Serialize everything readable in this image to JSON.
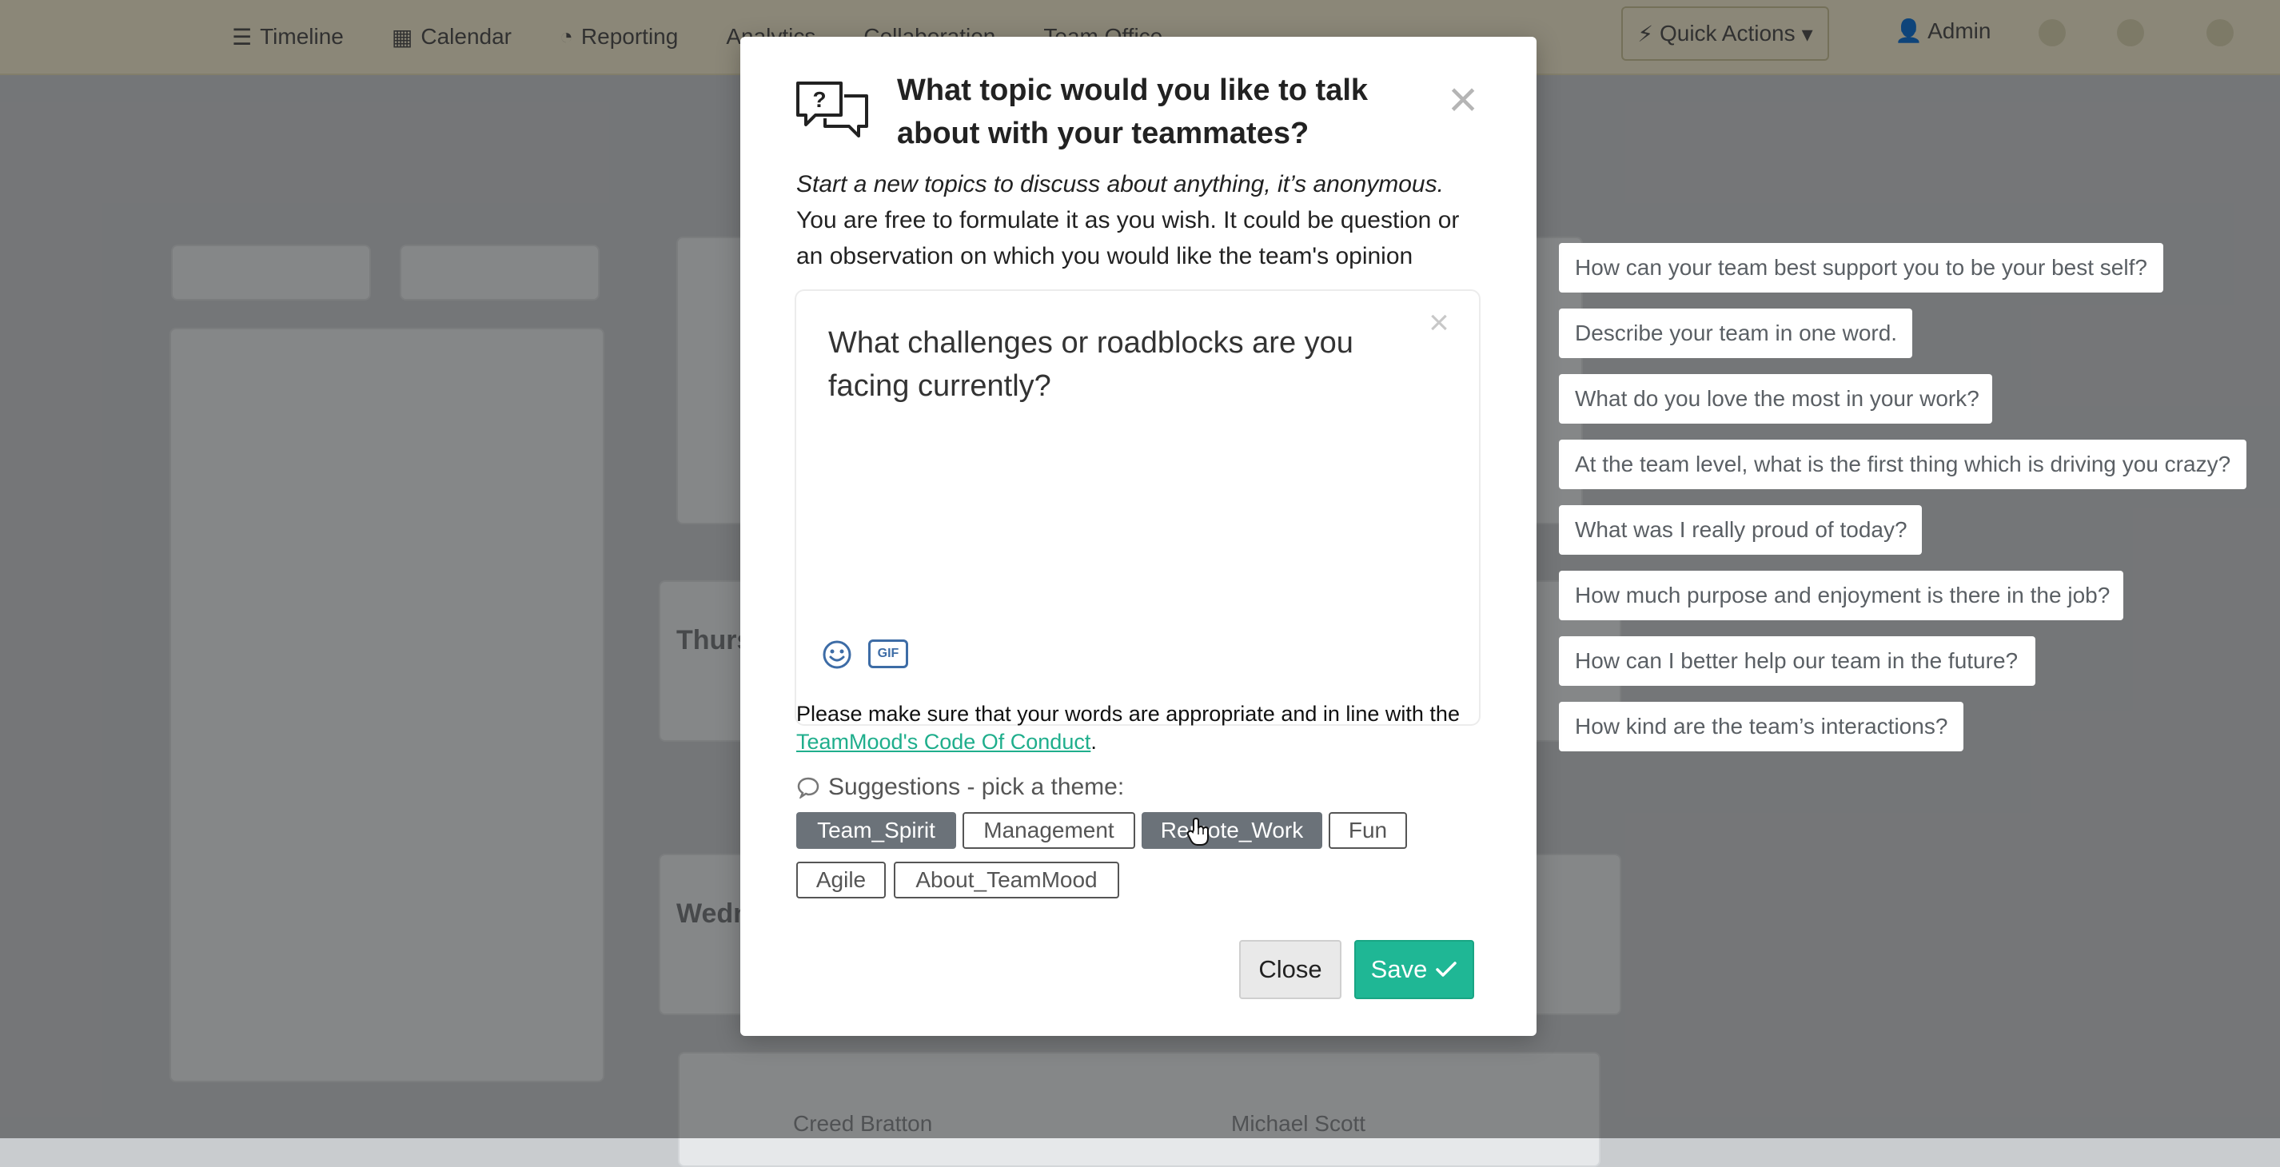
{
  "background": {
    "nav": [
      "Timeline",
      "Calendar",
      "Reporting",
      "Analytics",
      "Collaboration",
      "Team Office"
    ],
    "quick_actions": "Quick Actions",
    "admin": "Admin",
    "days": [
      "Thursday",
      "Wednesday"
    ],
    "people": [
      "Creed Bratton",
      "Michael Scott"
    ]
  },
  "side_suggestions": [
    "How can your team best support you to be your best self?",
    "Describe your team in one word.",
    "What do you love the most in your work?",
    "At the team level, what is the first thing which is driving you crazy?",
    "What was I really proud of today?",
    "How much purpose and enjoyment is there in the job?",
    "How can I better help our team in the future?",
    "How kind are the team’s interactions?"
  ],
  "modal": {
    "title": "What topic would you like to talk about with your teammates?",
    "desc_italic": "Start a new topics to discuss about anything, it’s anonymous.",
    "desc_rest": "You are free to formulate it as you wish. It could be question or an observation on which you would like the team's opinion",
    "topic_value": "What challenges or roadblocks are you facing currently?",
    "gif_label": "GIF",
    "conduct_text": "Please make sure that your words are appropriate and in line with the",
    "conduct_link": "TeamMood's Code Of Conduct",
    "conduct_end": ".",
    "suggestions_label": "Suggestions - pick a theme:",
    "themes": [
      "Team_Spirit",
      "Management",
      "Remote_Work",
      "Fun",
      "Agile",
      "About_TeamMood"
    ],
    "active_themes": [
      "Team_Spirit",
      "Remote_Work"
    ],
    "close_label": "Close",
    "save_label": "Save"
  },
  "colors": {
    "accent": "#1fb795",
    "chip_active": "#6b7279",
    "link": "#1fae8c"
  }
}
